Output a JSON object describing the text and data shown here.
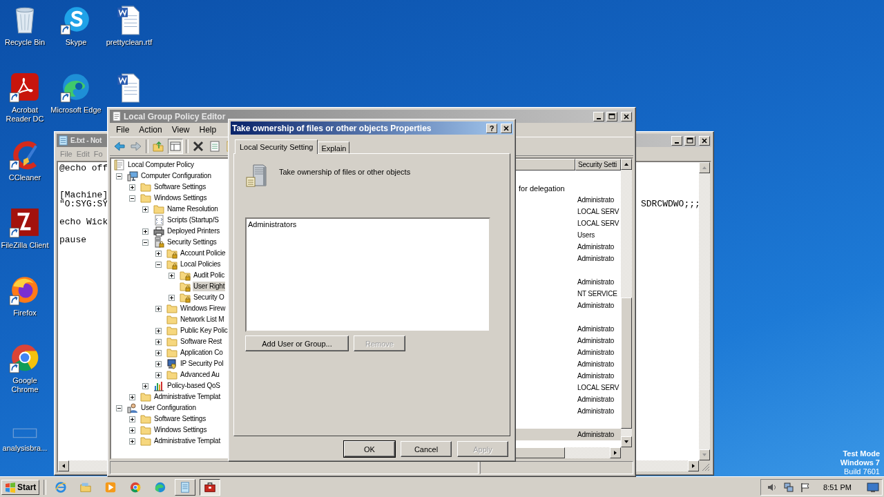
{
  "desktop_icons": [
    {
      "label": "Recycle Bin",
      "kind": "recycle",
      "shortcut": false
    },
    {
      "label": "Skype",
      "kind": "skype",
      "shortcut": true
    },
    {
      "label": "prettyclean.rtf",
      "kind": "word",
      "shortcut": false
    },
    {
      "label": "Acrobat Reader DC",
      "kind": "acrobat",
      "shortcut": true
    },
    {
      "label": "Microsoft Edge",
      "kind": "edge",
      "shortcut": true
    },
    {
      "kind": "word",
      "shortcut": false
    },
    {
      "label": "CCleaner",
      "kind": "ccleaner",
      "shortcut": true
    },
    {
      "label": "FileZilla Client",
      "kind": "filezilla",
      "shortcut": true
    },
    {
      "label": "Firefox",
      "kind": "firefox",
      "shortcut": true
    },
    {
      "label": "Google Chrome",
      "kind": "chrome",
      "shortcut": true
    },
    {
      "label": "analysisbra...",
      "kind": "blank",
      "shortcut": false
    }
  ],
  "os_mark": [
    "Test Mode",
    "Windows 7",
    "Build 7601"
  ],
  "notepad": {
    "title": "E.txt - Not",
    "menu": [
      "File",
      "Edit",
      "Fo"
    ],
    "lines": [
      {
        "text": "@echo off",
        "kind": "plain"
      },
      {
        "text": "[Machine]",
        "kind": "after-double-gap"
      },
      {
        "text": "\"O:SYG:SY",
        "tail": "SDRCWDWO;;;",
        "kind": "plain"
      },
      {
        "text": "echo Wick",
        "kind": "after-gap"
      },
      {
        "text": "pause",
        "kind": "after-gap"
      }
    ]
  },
  "gpo": {
    "title": "Local Group Policy Editor",
    "menu": [
      "File",
      "Action",
      "View",
      "Help"
    ],
    "tree": [
      {
        "label": "Local Computer Policy",
        "kind": "policy",
        "selected": false,
        "children": [
          {
            "label": "Computer Configuration",
            "kind": "computer",
            "expanded": true,
            "selected": false,
            "children": [
              {
                "label": "Software Settings",
                "kind": "folder",
                "expanded": false,
                "selected": false
              },
              {
                "label": "Windows Settings",
                "kind": "folder",
                "expanded": true,
                "selected": false,
                "children": [
                  {
                    "label": "Name Resolution",
                    "kind": "folder",
                    "expanded": false,
                    "selected": false
                  },
                  {
                    "label": "Scripts (Startup/S",
                    "kind": "script",
                    "selected": false
                  },
                  {
                    "label": "Deployed Printers",
                    "kind": "printer",
                    "expanded": false,
                    "selected": false
                  },
                  {
                    "label": "Security Settings",
                    "kind": "security",
                    "expanded": true,
                    "selected": false,
                    "children": [
                      {
                        "label": "Account Policie",
                        "kind": "locked",
                        "expanded": false,
                        "selected": false
                      },
                      {
                        "label": "Local Policies",
                        "kind": "locked",
                        "expanded": true,
                        "selected": false,
                        "children": [
                          {
                            "label": "Audit Polic",
                            "kind": "locked",
                            "expanded": false,
                            "selected": false
                          },
                          {
                            "label": "User Right",
                            "kind": "locked",
                            "selected": true
                          },
                          {
                            "label": "Security O",
                            "kind": "locked",
                            "expanded": false,
                            "selected": false
                          }
                        ]
                      },
                      {
                        "label": "Windows Firew",
                        "kind": "folder",
                        "expanded": false,
                        "selected": false
                      },
                      {
                        "label": "Network List M",
                        "kind": "folder",
                        "selected": false
                      },
                      {
                        "label": "Public Key Polic",
                        "kind": "folder",
                        "expanded": false,
                        "selected": false
                      },
                      {
                        "label": "Software Rest",
                        "kind": "folder",
                        "expanded": false,
                        "selected": false
                      },
                      {
                        "label": "Application Co",
                        "kind": "folder",
                        "expanded": false,
                        "selected": false
                      },
                      {
                        "label": "IP Security Pol",
                        "kind": "ipsec",
                        "expanded": false,
                        "selected": false
                      },
                      {
                        "label": "Advanced Au",
                        "kind": "folder",
                        "expanded": false,
                        "selected": false
                      }
                    ]
                  },
                  {
                    "label": "Policy-based QoS",
                    "kind": "qos",
                    "expanded": false,
                    "selected": false
                  }
                ]
              },
              {
                "label": "Administrative Templat",
                "kind": "folder",
                "expanded": false,
                "selected": false
              }
            ]
          },
          {
            "label": "User Configuration",
            "kind": "user",
            "expanded": true,
            "selected": false,
            "children": [
              {
                "label": "Software Settings",
                "kind": "folder",
                "expanded": false,
                "selected": false
              },
              {
                "label": "Windows Settings",
                "kind": "folder",
                "expanded": false,
                "selected": false
              },
              {
                "label": "Administrative Templat",
                "kind": "folder",
                "expanded": false,
                "selected": false
              }
            ]
          }
        ]
      }
    ],
    "column_2": "Security Setti",
    "rows": [
      {
        "selected": false
      },
      {
        "policy": "for delegation",
        "selected": false
      },
      {
        "setting": "Administrato",
        "selected": false
      },
      {
        "setting": "LOCAL SERV",
        "selected": false
      },
      {
        "setting": "LOCAL SERV",
        "selected": false
      },
      {
        "setting": "Users",
        "selected": false
      },
      {
        "setting": "Administrato",
        "selected": false
      },
      {
        "setting": "Administrato",
        "selected": false
      },
      {
        "selected": false
      },
      {
        "setting": "Administrato",
        "selected": false
      },
      {
        "setting": "NT SERVICE",
        "selected": false
      },
      {
        "setting": "Administrato",
        "selected": false
      },
      {
        "selected": false
      },
      {
        "setting": "Administrato",
        "selected": false
      },
      {
        "setting": "Administrato",
        "selected": false
      },
      {
        "setting": "Administrato",
        "selected": false
      },
      {
        "setting": "Administrato",
        "selected": false
      },
      {
        "setting": "Administrato",
        "selected": false
      },
      {
        "setting": "LOCAL SERV",
        "selected": false
      },
      {
        "setting": "Administrato",
        "selected": false
      },
      {
        "setting": "Administrato",
        "selected": false
      },
      {
        "selected": false
      },
      {
        "setting": "Administrato",
        "selected": true
      }
    ]
  },
  "dialog": {
    "title": "Take ownership of files or other objects Properties",
    "help_button": "?",
    "tabs": [
      {
        "label": "Local Security Setting",
        "selected": true
      },
      {
        "label": "Explain",
        "selected": false
      }
    ],
    "heading": "Take ownership of files or other objects",
    "members": [
      "Administrators"
    ],
    "list_buttons": [
      {
        "label": "Add User or Group...",
        "disabled": false
      },
      {
        "label": "Remove",
        "disabled": true
      }
    ],
    "buttons": [
      {
        "label": "OK",
        "disabled": false,
        "default": true
      },
      {
        "label": "Cancel",
        "disabled": false,
        "default": false
      },
      {
        "label": "Apply",
        "disabled": true,
        "default": false
      }
    ]
  },
  "taskbar": {
    "start": "Start",
    "apps": [
      {
        "kind": "ie",
        "open": false,
        "active": false
      },
      {
        "kind": "explorer",
        "open": false,
        "active": false
      },
      {
        "kind": "media",
        "open": false,
        "active": false
      },
      {
        "kind": "chrome",
        "open": false,
        "active": false
      },
      {
        "kind": "edge",
        "open": false,
        "active": false
      },
      {
        "kind": "notepad",
        "open": true,
        "active": false
      },
      {
        "kind": "gpo",
        "open": true,
        "active": true
      }
    ],
    "clock": "8:51 PM"
  }
}
